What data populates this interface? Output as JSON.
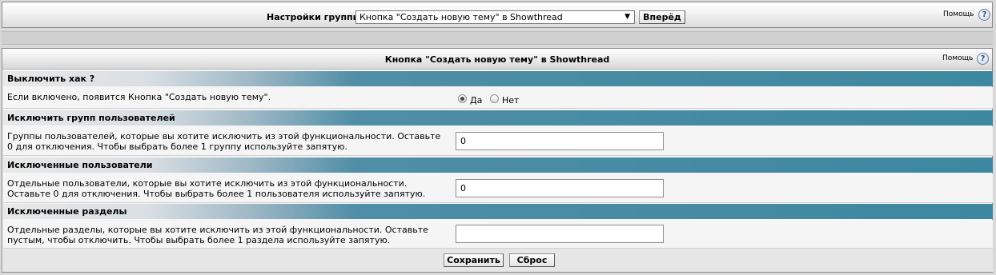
{
  "topbar": {
    "label": "Настройки группы",
    "select_value": "Кнопка \"Создать новую тему\" в Showthread",
    "go_button": "Вперёд",
    "help": "Помощь"
  },
  "panel": {
    "title": "Кнопка \"Создать новую тему\" в Showthread",
    "help": "Помощь"
  },
  "settings": [
    {
      "heading": "Выключить хак ?",
      "description": "Если включено, появится Кнопка \"Создать новую тему\".",
      "options": [
        "Да",
        "Нет"
      ],
      "selected": "Да"
    },
    {
      "heading": "Исключить групп пользователей",
      "description": "Группы пользователей, которые вы хотите исключить из этой функциональности. Оставьте 0 для отключения. Чтобы выбрать более 1 группу используйте запятую.",
      "value": "0"
    },
    {
      "heading": "Исключенные пользователи",
      "description": "Отдельные пользователи, которые вы хотите исключить из этой функциональности. Оставьте 0 для отключения. Чтобы выбрать более 1 пользователя используйте запятую.",
      "value": "0"
    },
    {
      "heading": "Исключенные разделы",
      "description": "Отдельные разделы, которые вы хотите исключить из этой функциональности. Оставьте пустым, чтобы отключить. Чтобы выбрать более 1 раздела используйте запятую.",
      "value": ""
    }
  ],
  "footer": {
    "save_button": "Сохранить",
    "reset_button": "Сброс"
  }
}
